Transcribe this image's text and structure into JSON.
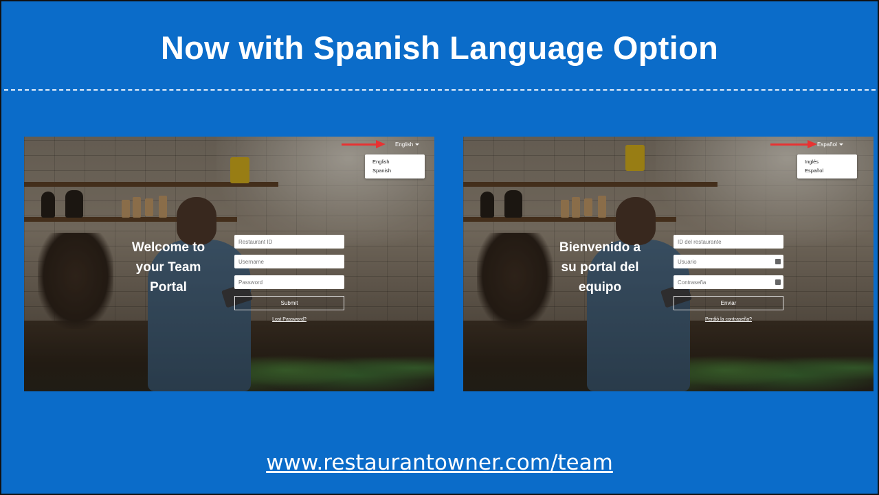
{
  "title": "Now with Spanish Language Option",
  "footer_url": "www.restaurantowner.com/team",
  "screens": {
    "english": {
      "language_toggle": "English",
      "menu_items": [
        "English",
        "Spanish"
      ],
      "welcome": [
        "Welcome to",
        "your Team",
        "Portal"
      ],
      "restaurant_id_placeholder": "Restaurant ID",
      "username_placeholder": "Username",
      "password_placeholder": "Password",
      "submit_label": "Submit",
      "forgot_link": "Lost Password?"
    },
    "spanish": {
      "language_toggle": "Español",
      "menu_items": [
        "Inglés",
        "Español"
      ],
      "welcome": [
        "Bienvenido a",
        "su portal del",
        "equipo"
      ],
      "restaurant_id_placeholder": "ID del restaurante",
      "username_placeholder": "Usuario",
      "password_placeholder": "Contraseña",
      "submit_label": "Enviar",
      "forgot_link": "Perdió la contraseña?"
    }
  },
  "colors": {
    "background": "#0b6cc9",
    "arrow": "#e83232"
  },
  "icons": [
    "dropdown-caret-icon",
    "red-arrow-icon",
    "password-manager-icon"
  ]
}
